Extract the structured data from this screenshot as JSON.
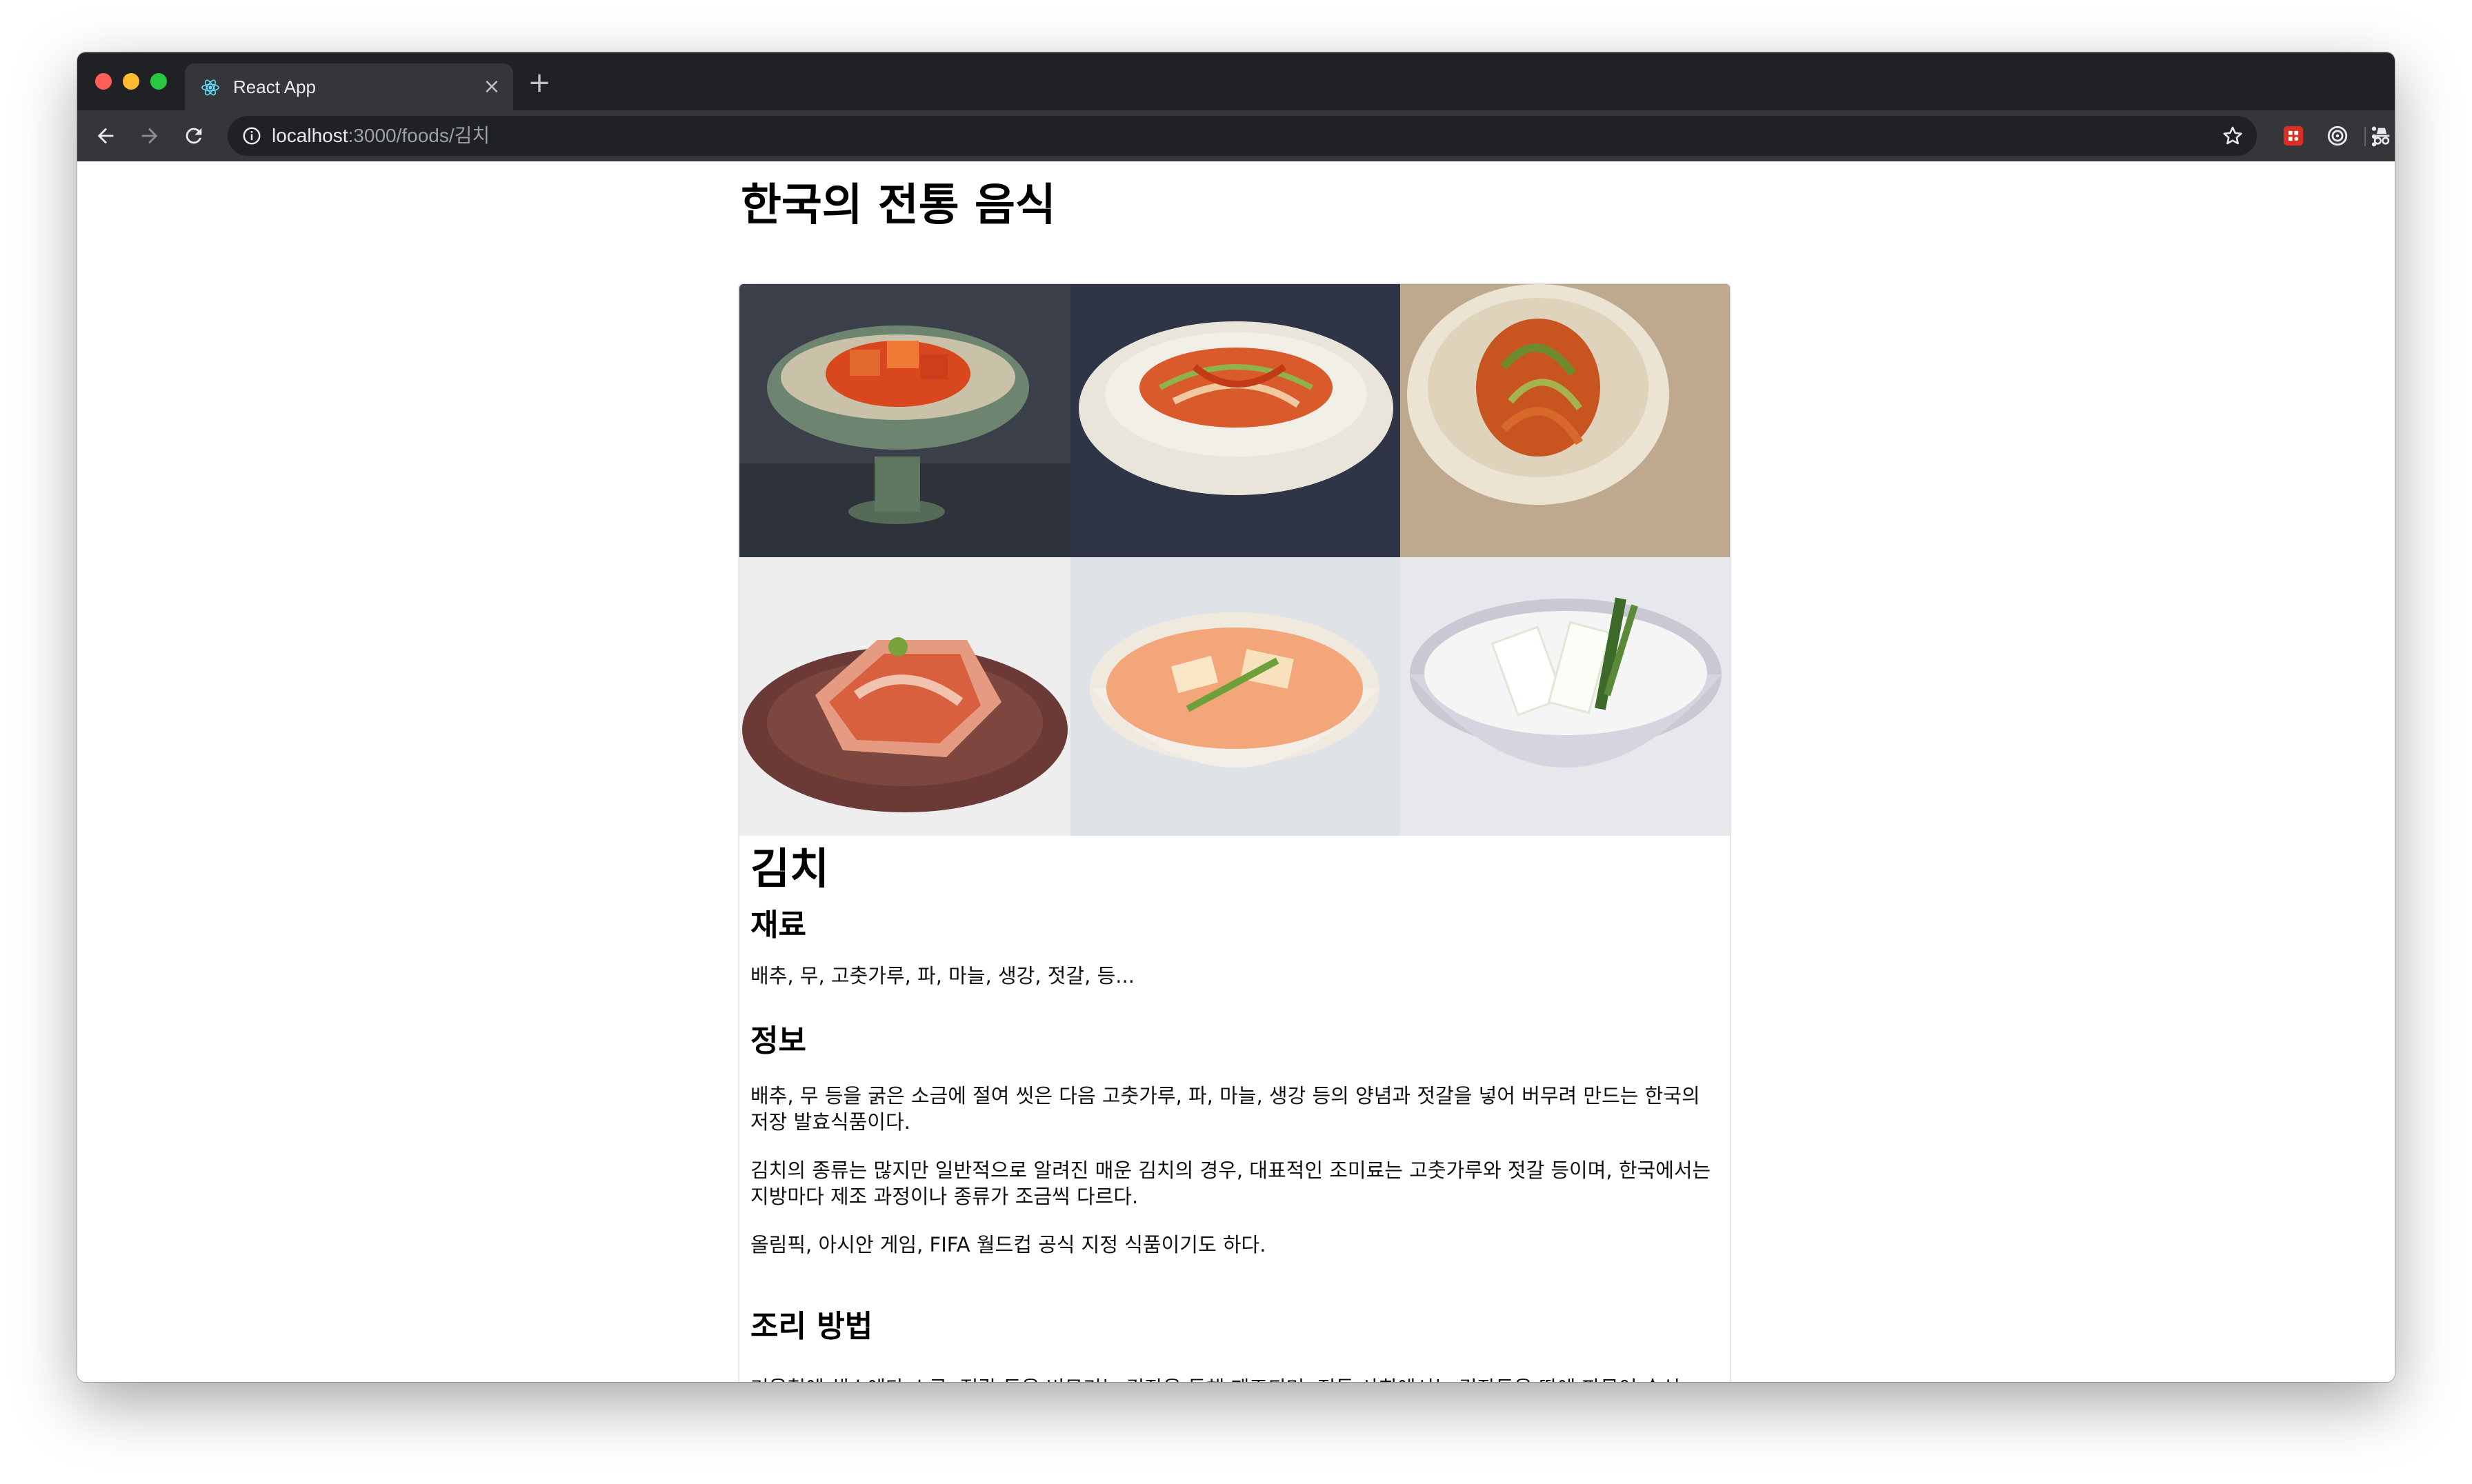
{
  "browser": {
    "tab_title": "React App",
    "tab_close": "×",
    "new_tab": "+",
    "url_host": "localhost",
    "url_path": ":3000/foods/김치",
    "icons": [
      "react-favicon-icon",
      "back-arrow-icon",
      "forward-arrow-icon",
      "reload-icon",
      "info-icon",
      "bookmark-star-icon",
      "extension-icon",
      "target-extension-icon",
      "incognito-icon",
      "menu-kebab-icon"
    ]
  },
  "page": {
    "title": "한국의 전통 음식"
  },
  "food": {
    "name": "김치",
    "ingredients_heading": "재료",
    "ingredients": "배추, 무, 고춧가루, 파, 마늘, 생강, 젓갈, 등...",
    "info_heading": "정보",
    "info_paragraphs": [
      "배추, 무 등을 굵은 소금에 절여 씻은 다음 고춧가루, 파, 마늘, 생강 등의 양념과 젓갈을 넣어 버무려 만드는 한국의 저장 발효식품이다.",
      "김치의 종류는 많지만 일반적으로 알려진 매운 김치의 경우, 대표적인 조미료는 고춧가루와 젓갈 등이며, 한국에서는 지방마다 제조 과정이나 종류가 조금씩 다르다.",
      "올림픽, 아시안 게임, FIFA 월드컵 공식 지정 식품이기도 하다."
    ],
    "recipe_heading": "조리 방법",
    "recipe_text": "겨울철에 채소에다 소금, 젓갈 등을 버무리는 김장을 통해 제조되며, 전통 사회에서는 김장독을 땅에 파묻어 숙성"
  }
}
